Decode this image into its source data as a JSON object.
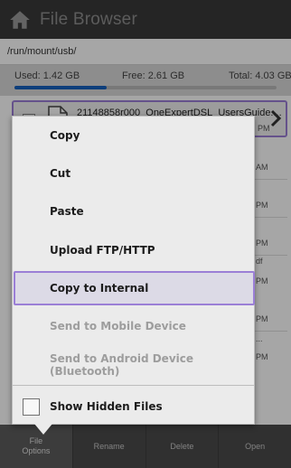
{
  "app": {
    "title": "File Browser",
    "home_icon": "home-icon"
  },
  "path": "/run/mount/usb/",
  "storage": {
    "used": "Used: 1.42 GB",
    "free": "Free: 2.61 GB",
    "total": "Total: 4.03 GB",
    "used_fraction": 0.35,
    "bar_color": "#1560bd"
  },
  "files": [
    {
      "name": "21148858r000_OneExpertDSL_UsersGuide....",
      "meta": "PM"
    },
    {
      "name": "",
      "meta": "AM"
    },
    {
      "name": "",
      "meta": "PM"
    },
    {
      "name": "",
      "meta": "PM"
    },
    {
      "name": "",
      "meta": "df"
    },
    {
      "name": "",
      "meta": "PM"
    },
    {
      "name": "",
      "meta": "PM"
    },
    {
      "name": "",
      "meta": "..."
    },
    {
      "name": "",
      "meta": "PM"
    }
  ],
  "menu": {
    "items": [
      {
        "label": "Copy",
        "enabled": true
      },
      {
        "label": "Cut",
        "enabled": true
      },
      {
        "label": "Paste",
        "enabled": true
      },
      {
        "label": "Upload FTP/HTTP",
        "enabled": true
      },
      {
        "label": "Copy to Internal",
        "enabled": true,
        "selected": true
      },
      {
        "label": "Send to Mobile Device",
        "enabled": false
      },
      {
        "label": "Send to Android Device (Bluetooth)",
        "enabled": false
      }
    ],
    "show_hidden": {
      "label": "Show Hidden Files",
      "checked": false
    }
  },
  "toolbar": {
    "file_options": "File\nOptions",
    "rename": "Rename",
    "delete": "Delete",
    "open": "Open"
  },
  "colors": {
    "titlebar": "#3a3a3a",
    "highlight_border": "#9b7fd6",
    "toolbar": "#4a4a4a"
  }
}
